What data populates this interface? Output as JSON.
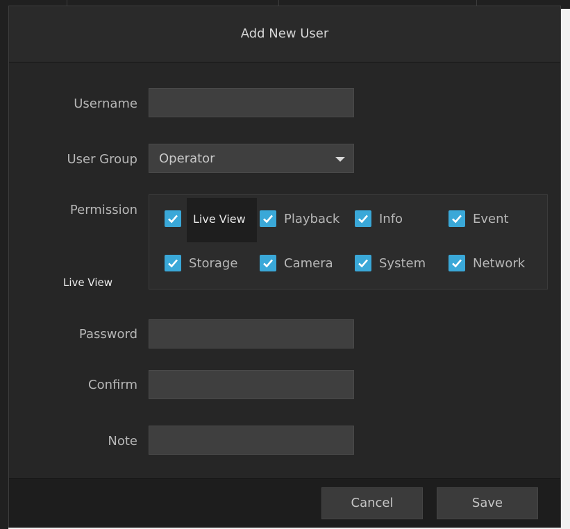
{
  "dialog": {
    "title": "Add New User"
  },
  "form": {
    "username": {
      "label": "Username",
      "value": ""
    },
    "user_group": {
      "label": "User Group",
      "value": "Operator"
    },
    "permission": {
      "label": "Permission",
      "items": [
        {
          "label": "Live View",
          "checked": true
        },
        {
          "label": "Playback",
          "checked": true
        },
        {
          "label": "Info",
          "checked": true
        },
        {
          "label": "Event",
          "checked": true
        },
        {
          "label": "Storage",
          "checked": true
        },
        {
          "label": "Camera",
          "checked": true
        },
        {
          "label": "System",
          "checked": true
        },
        {
          "label": "Network",
          "checked": true
        }
      ],
      "tooltip": "Live View"
    },
    "password": {
      "label": "Password",
      "value": ""
    },
    "confirm": {
      "label": "Confirm",
      "value": ""
    },
    "note": {
      "label": "Note",
      "value": ""
    }
  },
  "footer": {
    "cancel_label": "Cancel",
    "save_label": "Save"
  },
  "colors": {
    "checkbox": "#3aa8d8",
    "dialog_bg": "#262626",
    "field_bg": "#3f3f3f"
  },
  "icons": {
    "check": "check-icon",
    "dropdown": "chevron-down-icon"
  }
}
